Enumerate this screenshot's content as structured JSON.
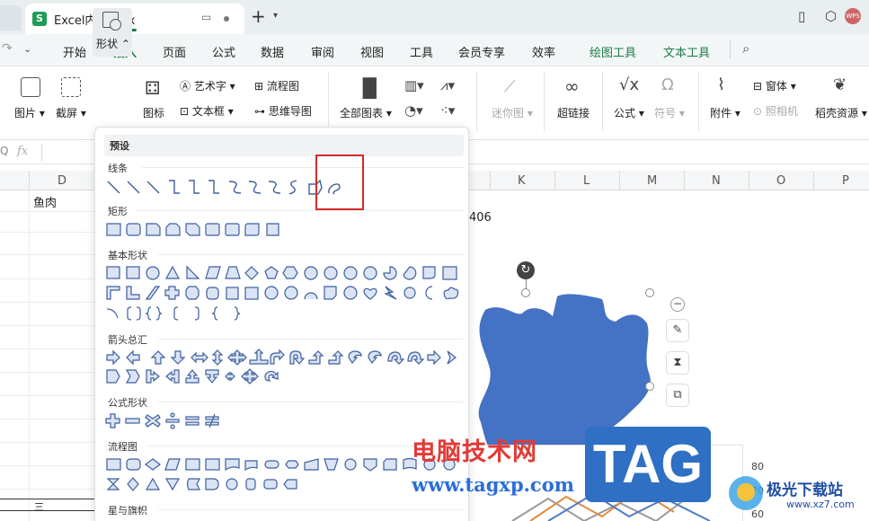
{
  "window": {
    "tab_title": "Excel内容.xlsx",
    "file_badge": "S",
    "avatar": "WPS"
  },
  "menu": {
    "items": [
      "开始",
      "插入",
      "页面",
      "公式",
      "数据",
      "审阅",
      "视图",
      "工具",
      "会员专享",
      "效率",
      "绘图工具",
      "文本工具"
    ],
    "active": "插入"
  },
  "ribbon": {
    "picture": "图片",
    "screenshot": "截屏",
    "shapes": "形状",
    "icons": "图标",
    "wordart": "艺术字",
    "textbox": "文本框",
    "flowchart": "流程图",
    "mindmap": "思维导图",
    "all_charts": "全部图表",
    "sparkline": "迷你图",
    "hyperlink": "超链接",
    "formula": "公式",
    "symbol": "符号",
    "attachment": "附件",
    "window_obj": "窗体",
    "camera": "照相机",
    "resources": "稻壳资源"
  },
  "formula_bar": {
    "fx": "fx"
  },
  "sheet": {
    "columns_left": [
      "D"
    ],
    "columns_right": [
      "K",
      "L",
      "M",
      "N",
      "O",
      "P"
    ],
    "cell_d": "鱼肉",
    "cell_406": "406",
    "cell_bottom": "三"
  },
  "dropdown": {
    "header": "预设",
    "sections": [
      "线条",
      "矩形",
      "基本形状",
      "箭头总汇",
      "公式形状",
      "流程图",
      "星与旗帜"
    ]
  },
  "chart_data": {
    "type": "line",
    "y_ticks": [
      80,
      70,
      60
    ]
  },
  "watermark": {
    "site": "电脑技术网",
    "url": "www.tagxp.com",
    "tag": "TAG",
    "brand": "极光下载站",
    "brand_url": "www.xz7.com"
  },
  "colors": {
    "accent": "#1f7c49",
    "shape_fill": "#4472c4",
    "highlight": "#d42a2a"
  }
}
